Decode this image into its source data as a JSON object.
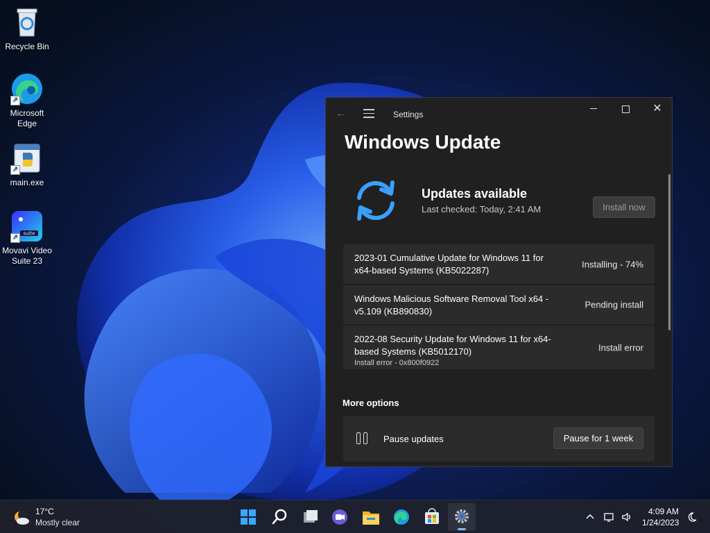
{
  "desktop": {
    "icons": [
      {
        "label": "Recycle Bin"
      },
      {
        "label": "Microsoft Edge"
      },
      {
        "label": "main.exe"
      },
      {
        "label": "Movavi Video Suite 23"
      }
    ]
  },
  "window": {
    "title": "Settings",
    "page_title": "Windows Update",
    "status_title": "Updates available",
    "status_sub": "Last checked: Today, 2:41 AM",
    "install_button": "Install now",
    "updates": [
      {
        "name": "2023-01 Cumulative Update for Windows 11 for x64-based Systems (KB5022287)",
        "status": "Installing - 74%",
        "error": ""
      },
      {
        "name": "Windows Malicious Software Removal Tool x64 - v5.109 (KB890830)",
        "status": "Pending install",
        "error": ""
      },
      {
        "name": "2022-08 Security Update for Windows 11 for x64-based Systems (KB5012170)",
        "status": "Install error",
        "error": "Install error - 0x800f0922"
      }
    ],
    "more_options_heading": "More options",
    "pause_label": "Pause updates",
    "pause_button": "Pause for 1 week"
  },
  "taskbar": {
    "weather_temp": "17°C",
    "weather_desc": "Mostly clear",
    "apps": [
      "start",
      "search",
      "task-view",
      "chat",
      "file-explorer",
      "edge",
      "store",
      "settings"
    ],
    "active_app": "settings",
    "time": "4:09 AM",
    "date": "1/24/2023"
  },
  "colors": {
    "accent": "#0067c0",
    "update_icon": "#3aa0ff",
    "window_bg": "#202020",
    "card_bg": "#2b2b2b"
  }
}
